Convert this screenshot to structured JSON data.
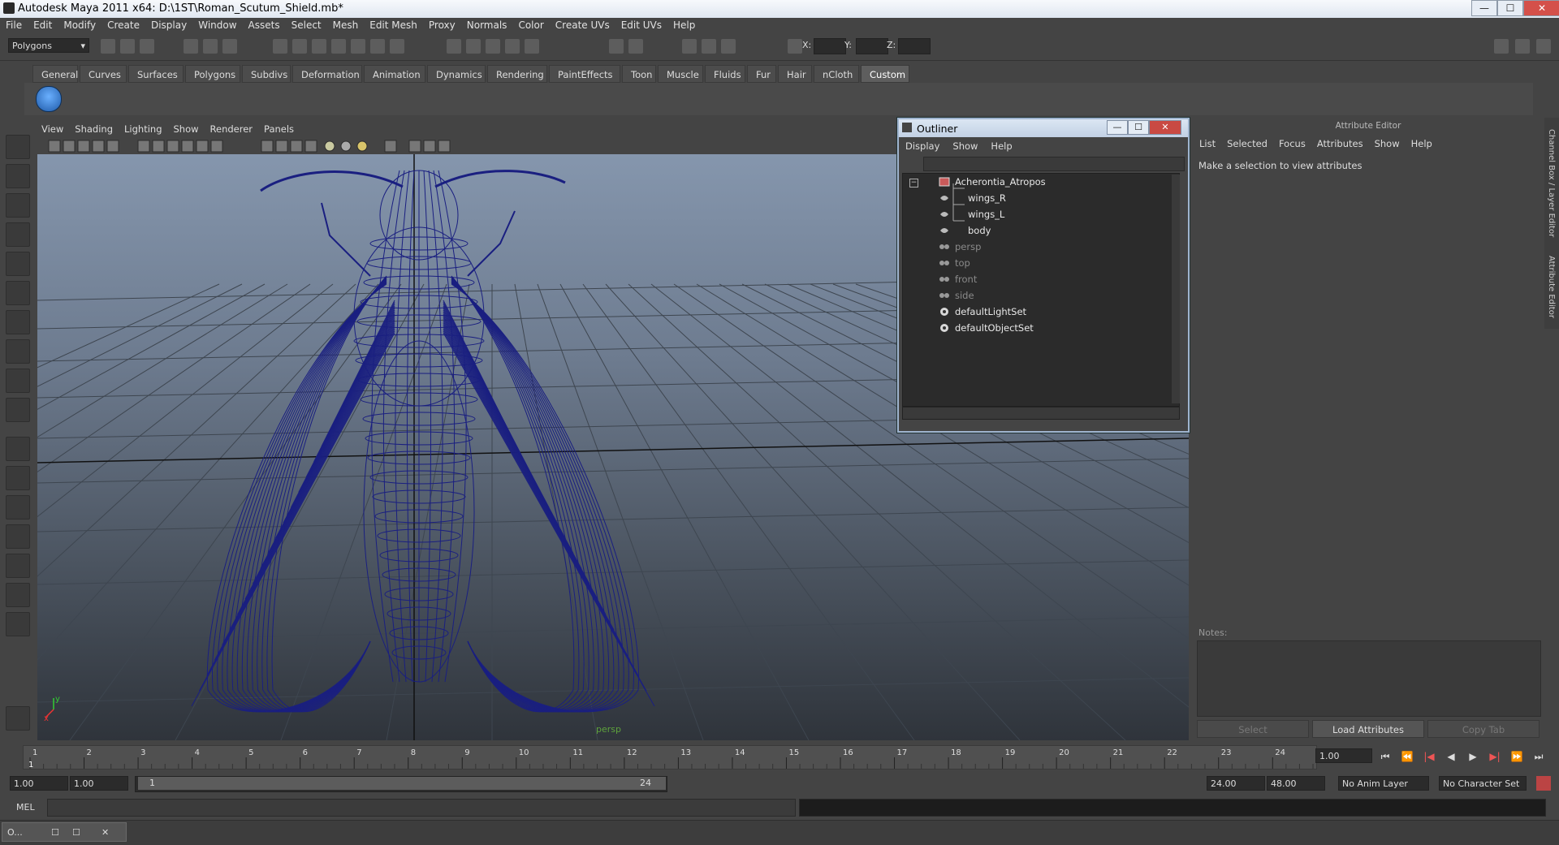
{
  "window": {
    "title": "Autodesk Maya 2011 x64: D:\\1ST\\Roman_Scutum_Shield.mb*",
    "controls": {
      "minimize": "—",
      "maximize": "☐",
      "close": "✕"
    }
  },
  "menubar": [
    "File",
    "Edit",
    "Modify",
    "Create",
    "Display",
    "Window",
    "Assets",
    "Select",
    "Mesh",
    "Edit Mesh",
    "Proxy",
    "Normals",
    "Color",
    "Create UVs",
    "Edit UVs",
    "Help"
  ],
  "statusline": {
    "mode": "Polygons",
    "x_label": "X:",
    "y_label": "Y:",
    "z_label": "Z:",
    "x_value": "",
    "y_value": "",
    "z_value": ""
  },
  "shelf": {
    "tabs": [
      "General",
      "Curves",
      "Surfaces",
      "Polygons",
      "Subdivs",
      "Deformation",
      "Animation",
      "Dynamics",
      "Rendering",
      "PaintEffects",
      "Toon",
      "Muscle",
      "Fluids",
      "Fur",
      "Hair",
      "nCloth",
      "Custom"
    ],
    "active_tab": "Custom"
  },
  "viewport": {
    "menu": [
      "View",
      "Shading",
      "Lighting",
      "Show",
      "Renderer",
      "Panels"
    ],
    "camera_label": "persp",
    "wire_color": "#1a1f80"
  },
  "outliner": {
    "title": "Outliner",
    "menu": [
      "Display",
      "Show",
      "Help"
    ],
    "items": [
      {
        "label": "Acherontia_Atropos",
        "icon": "group-icon",
        "dim": false
      },
      {
        "label": "wings_R",
        "icon": "mesh-icon",
        "dim": false
      },
      {
        "label": "wings_L",
        "icon": "mesh-icon",
        "dim": false
      },
      {
        "label": "body",
        "icon": "mesh-icon",
        "dim": false
      },
      {
        "label": "persp",
        "icon": "camera-icon",
        "dim": true
      },
      {
        "label": "top",
        "icon": "camera-icon",
        "dim": true
      },
      {
        "label": "front",
        "icon": "camera-icon",
        "dim": true
      },
      {
        "label": "side",
        "icon": "camera-icon",
        "dim": true
      },
      {
        "label": "defaultLightSet",
        "icon": "set-icon",
        "dim": false
      },
      {
        "label": "defaultObjectSet",
        "icon": "set-icon",
        "dim": false
      }
    ]
  },
  "attribute_editor": {
    "title": "Attribute Editor",
    "menu": [
      "List",
      "Selected",
      "Focus",
      "Attributes",
      "Show",
      "Help"
    ],
    "message": "Make a selection to view attributes",
    "notes_label": "Notes:",
    "buttons": {
      "select": "Select",
      "load": "Load Attributes",
      "copy": "Copy Tab"
    }
  },
  "side_tabs": {
    "channel_box": "Channel Box / Layer Editor",
    "attribute_editor": "Attribute Editor"
  },
  "timeline": {
    "ticks": [
      "1",
      "2",
      "3",
      "4",
      "5",
      "6",
      "7",
      "8",
      "9",
      "10",
      "11",
      "12",
      "13",
      "14",
      "15",
      "16",
      "17",
      "18",
      "19",
      "20",
      "21",
      "22",
      "23",
      "24"
    ],
    "current_frame_marker": "1",
    "current_frame": "1.00",
    "play_buttons": [
      "⏮",
      "⏪",
      "|◀",
      "◀",
      "▶",
      "▶|",
      "⏩",
      "⏭"
    ]
  },
  "range": {
    "start": "1.00",
    "playback_start": "1.00",
    "slider_start": "1",
    "slider_end": "24",
    "playback_end": "24.00",
    "end": "48.00",
    "anim_layer": "No Anim Layer",
    "character_set": "No Character Set"
  },
  "cmdline": {
    "label": "MEL"
  },
  "taskbar": {
    "item_label": "O..."
  }
}
